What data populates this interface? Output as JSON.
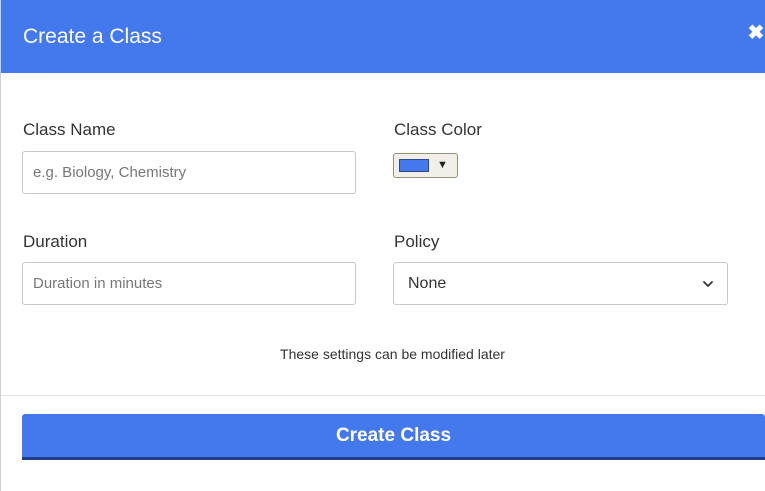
{
  "modal": {
    "title": "Create a Class",
    "close_icon": "times-icon"
  },
  "form": {
    "class_name": {
      "label": "Class Name",
      "placeholder": "e.g. Biology, Chemistry",
      "value": ""
    },
    "class_color": {
      "label": "Class Color",
      "value": "#4479ee",
      "arrow": "▼"
    },
    "duration": {
      "label": "Duration",
      "placeholder": "Duration in minutes",
      "value": ""
    },
    "policy": {
      "label": "Policy",
      "selected": "None"
    },
    "hint": "These settings can be modified later"
  },
  "actions": {
    "create_label": "Create Class"
  },
  "colors": {
    "accent": "#4479ee",
    "button_border": "#1f3e8a",
    "text": "#333333"
  }
}
